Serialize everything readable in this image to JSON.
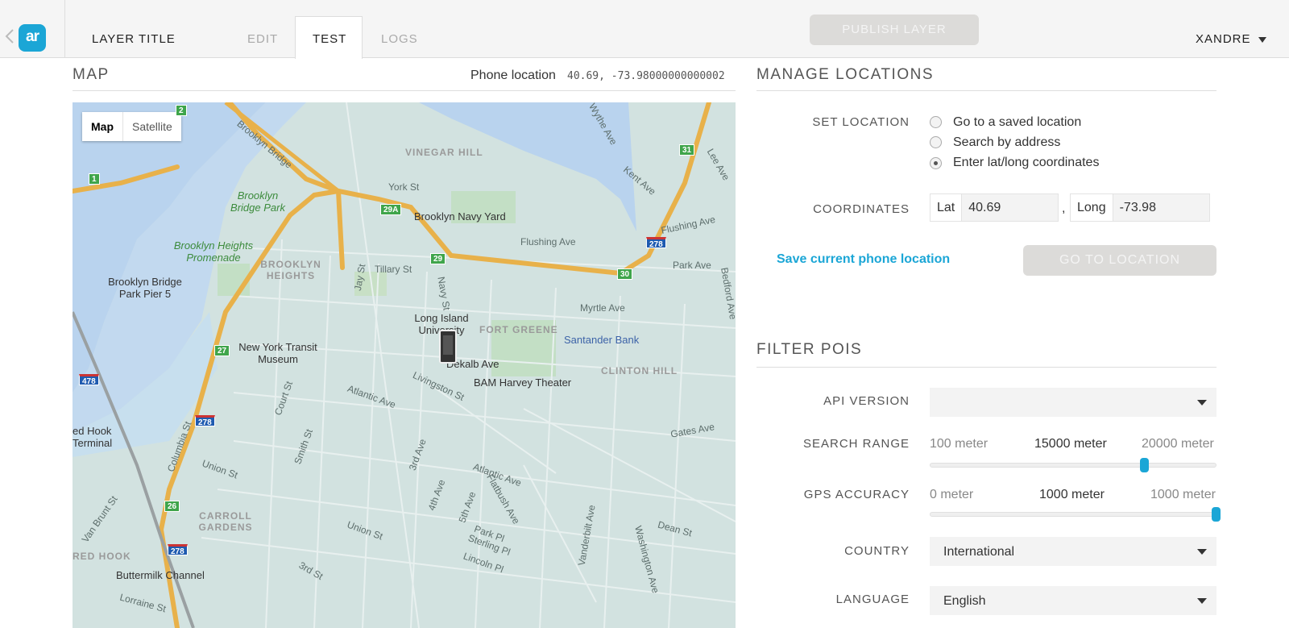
{
  "header": {
    "logo_text": "ar",
    "layer_title": "LAYER TITLE",
    "tabs": [
      "EDIT",
      "TEST",
      "LOGS"
    ],
    "active_tab": "TEST",
    "publish_label": "PUBLISH LAYER",
    "user_name": "XANDRE"
  },
  "map_panel": {
    "heading": "MAP",
    "phone_location_label": "Phone location",
    "phone_location_value": "40.69, -73.98000000000002",
    "map_type_options": [
      "Map",
      "Satellite"
    ],
    "selected_map_type": "Map",
    "labels": {
      "vinegar_hill": "VINEGAR HILL",
      "york_st": "York St",
      "brooklyn_bridge_park": "Brooklyn Bridge Park",
      "brooklyn_navy_yard": "Brooklyn Navy Yard",
      "flushing_ave": "Flushing Ave",
      "brooklyn_heights_promenade": "Brooklyn Heights Promenade",
      "brooklyn_heights": "BROOKLYN HEIGHTS",
      "tillary_st": "Tillary St",
      "park_ave": "Park Ave",
      "brooklyn_bridge_park_pier5": "Brooklyn Bridge Park Pier 5",
      "myrtle_ave": "Myrtle Ave",
      "long_island_university": "Long Island University",
      "fort_greene": "FORT GREENE",
      "santander_bank": "Santander Bank",
      "new_york_transit_museum": "New York Transit Museum",
      "dekalb_ave": "Dekalb Ave",
      "bam_harvey_theater": "BAM Harvey Theater",
      "clinton_hill": "CLINTON HILL",
      "atlantic_ave": "Atlantic Ave",
      "livingston_st": "Livingston St",
      "court_st": "Court St",
      "smith_st": "Smith St",
      "columbia_st": "Columbia St",
      "union_st": "Union St",
      "red_hook_terminal": "ed Hook Terminal",
      "carroll_gardens": "CARROLL GARDENS",
      "gates_ave": "Gates Ave",
      "third_ave": "3rd Ave",
      "fourth_ave": "4th Ave",
      "fifth_ave": "5th Ave",
      "flatbush_ave": "Flatbush Ave",
      "park_pl": "Park Pl",
      "sterling_pl": "Sterling Pl",
      "lincoln_pl": "Lincoln Pl",
      "vanderbilt_ave": "Vanderbilt Ave",
      "washington_ave": "Washington Ave",
      "dean_st": "Dean St",
      "red_hook": "RED HOOK",
      "buttermilk_channel": "Buttermilk Channel",
      "van_brunt_st": "Van Brunt St",
      "lorraine_st": "Lorraine St",
      "third_st": "3rd St",
      "brooklyn_bridge": "Brooklyn Bridge",
      "wythe_ave": "Wythe Ave",
      "kent_ave": "Kent Ave",
      "lee_ave": "Lee Ave",
      "bedford_ave": "Bedford Ave",
      "jay_st": "Jay St",
      "navy_st": "Navy St"
    },
    "shields": [
      "1",
      "2",
      "29A",
      "29",
      "30",
      "31",
      "278",
      "478",
      "27",
      "26"
    ]
  },
  "manage_locations": {
    "heading": "MANAGE LOCATIONS",
    "set_location_label": "SET LOCATION",
    "options": [
      "Go to a saved location",
      "Search by address",
      "Enter lat/long coordinates"
    ],
    "selected_option": "Enter lat/long coordinates",
    "coordinates_label": "COORDINATES",
    "lat_label": "Lat",
    "lat_value": "40.69",
    "long_label": "Long",
    "long_value": "-73.98",
    "separator": ",",
    "save_phone_location_label": "Save current phone location",
    "go_to_location_label": "GO TO LOCATION"
  },
  "filter_pois": {
    "heading": "FILTER POIS",
    "api_version_label": "API VERSION",
    "api_version_value": "",
    "search_range": {
      "label": "SEARCH RANGE",
      "min_label": "100 meter",
      "current_label": "15000 meter",
      "max_label": "20000 meter",
      "value": 15000,
      "min": 100,
      "max": 20000
    },
    "gps_accuracy": {
      "label": "GPS ACCURACY",
      "min_label": "0 meter",
      "current_label": "1000 meter",
      "max_label": "1000 meter",
      "value": 1000,
      "min": 0,
      "max": 1000
    },
    "country_label": "COUNTRY",
    "country_value": "International",
    "language_label": "LANGUAGE",
    "language_value": "English"
  },
  "colors": {
    "accent": "#1ba6d6",
    "disabled_button": "#dcdbd9",
    "water": "#b9d3ee",
    "land": "#d2e2e0",
    "highway": "#e8b14a"
  }
}
